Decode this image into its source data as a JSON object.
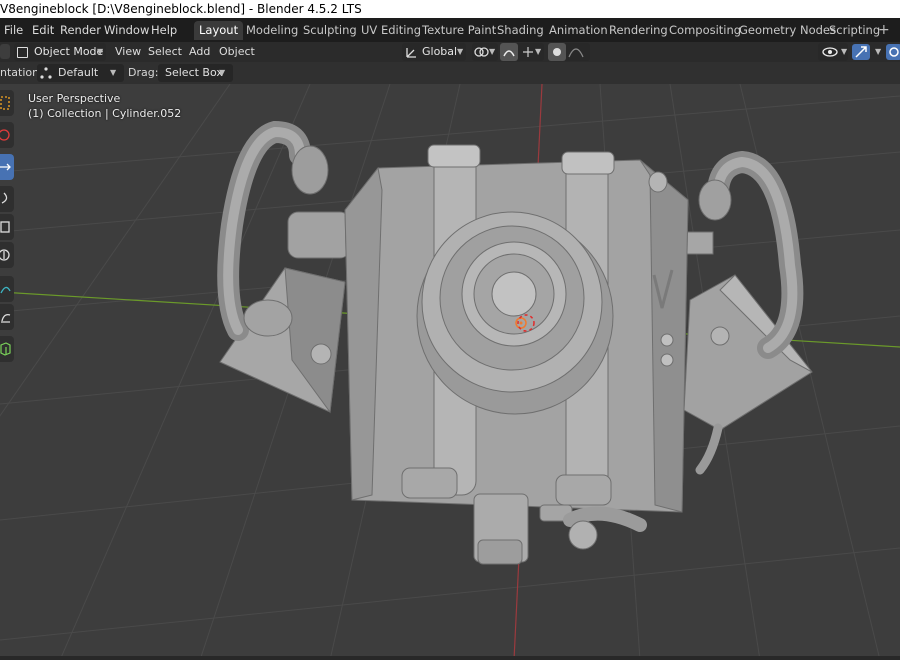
{
  "window": {
    "title": "V8engineblock [D:\\V8engineblock.blend] - Blender 4.5.2 LTS"
  },
  "menu": [
    "File",
    "Edit",
    "Render",
    "Window",
    "Help"
  ],
  "workspaces": {
    "tabs": [
      "Layout",
      "Modeling",
      "Sculpting",
      "UV Editing",
      "Texture Paint",
      "Shading",
      "Animation",
      "Rendering",
      "Compositing",
      "Geometry Nodes",
      "Scripting"
    ],
    "active": "Layout",
    "add": "+"
  },
  "header": {
    "mode": "Object Mode",
    "view": "View",
    "select": "Select",
    "add": "Add",
    "object": "Object",
    "transform_orientation": "Global"
  },
  "tool_settings": {
    "orientation_label": "ntation:",
    "orientation_value": "Default",
    "drag_label": "Drag:",
    "drag_value": "Select Box"
  },
  "viewport": {
    "perspective": "User Perspective",
    "collection_info": "(1) Collection | Cylinder.052",
    "colors": {
      "background": "#3d3d3d",
      "grid": "#4a4a4a",
      "x_axis": "#9b3a3e",
      "y_axis": "#6b9a2a",
      "model": "#9a9a9a",
      "model_light": "#b4b4b4",
      "model_dark": "#7e7e7e",
      "accent": "#4772b3"
    }
  },
  "icons": [
    "object-mode-icon",
    "transform-gizmo-icon",
    "snap-icon",
    "proportional-edit-icon",
    "overlay-icon",
    "gizmo-icon",
    "select-box-tool-icon",
    "cursor-tool-icon",
    "move-tool-icon",
    "rotate-tool-icon",
    "scale-tool-icon",
    "transform-tool-icon",
    "annotate-tool-icon",
    "measure-tool-icon",
    "add-cube-tool-icon",
    "origin-icon"
  ]
}
